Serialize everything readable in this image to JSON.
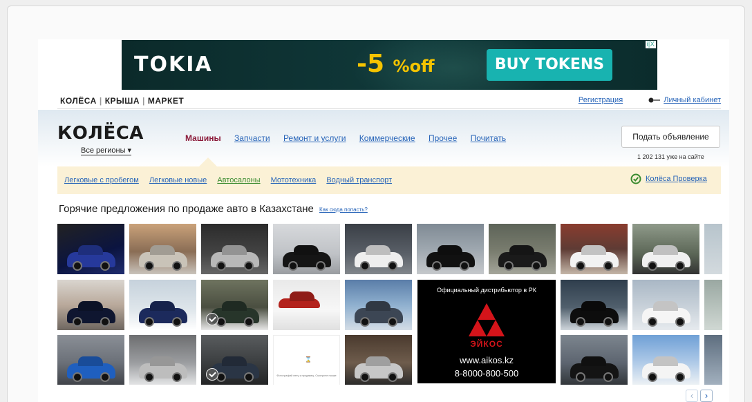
{
  "ad": {
    "logo": "TOKIA",
    "discount": "-5",
    "off": "%off",
    "button": "BUY TOKENS",
    "corner": "i|X"
  },
  "topbar": {
    "brands": [
      "КОЛЁСА",
      "КРЫША",
      "МАРКЕТ"
    ],
    "register": "Регистрация",
    "cabinet": "Личный кабинет"
  },
  "header": {
    "logo": "КОЛЁСА",
    "regions": "Все регионы ▾",
    "nav": [
      {
        "label": "Машины",
        "active": true
      },
      {
        "label": "Запчасти",
        "active": false
      },
      {
        "label": "Ремонт и услуги",
        "active": false
      },
      {
        "label": "Коммерческие",
        "active": false
      },
      {
        "label": "Прочее",
        "active": false
      },
      {
        "label": "Почитать",
        "active": false
      }
    ],
    "submit_button": "Подать объявление",
    "online_count": "1 202 131 уже на сайте"
  },
  "subnav": {
    "links": [
      {
        "label": "Легковые с пробегом",
        "green": false
      },
      {
        "label": "Легковые новые",
        "green": false
      },
      {
        "label": "Автосалоны",
        "green": true
      },
      {
        "label": "Мототехника",
        "green": false
      },
      {
        "label": "Водный транспорт",
        "green": false
      }
    ],
    "check_link": "Колёса Проверка"
  },
  "hot": {
    "title": "Горячие предложения по продаже авто в Казахстане",
    "how_link": "Как сюда попасть?"
  },
  "dealer_ad": {
    "heading": "Официальный дистрибьютор в РК",
    "name": "ЭЙКОС",
    "site": "www.aikos.kz",
    "phone": "8-8000-800-500"
  },
  "placeholder": {
    "text": "Фотографий нету к продавец. Смотрите позже"
  },
  "colors": {
    "link": "#2764b8",
    "active_nav": "#8b1a3a",
    "subnav_bg": "#fbf1d6",
    "check_green": "#3a8b2f",
    "ad_button": "#18b3b0",
    "ad_yellow": "#f5c400"
  },
  "pager": [
    "‹",
    "›"
  ]
}
